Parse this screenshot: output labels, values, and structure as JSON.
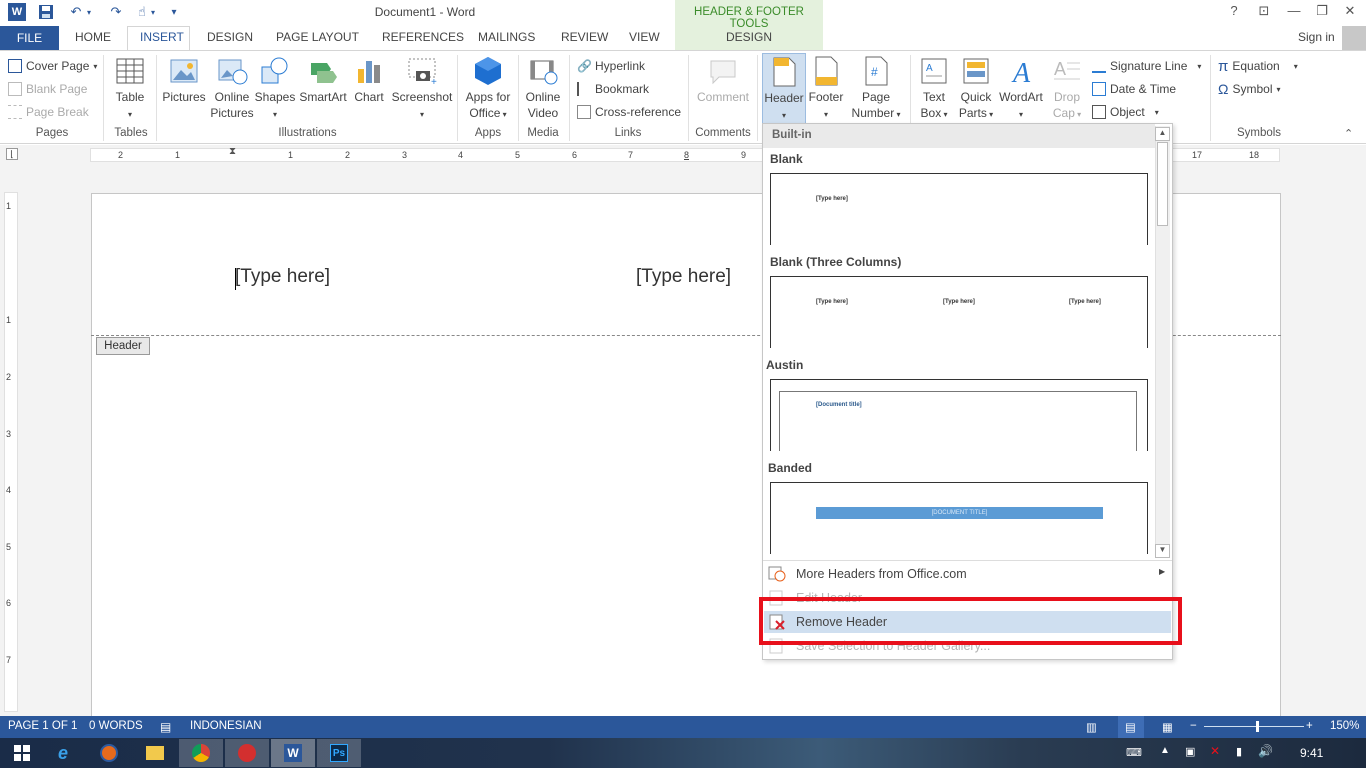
{
  "window": {
    "title": "Document1 - Word",
    "contextual_group": "HEADER & FOOTER TOOLS",
    "contextual_tab": "DESIGN",
    "help": "?",
    "sign_in": "Sign in"
  },
  "tabs": [
    "FILE",
    "HOME",
    "INSERT",
    "DESIGN",
    "PAGE LAYOUT",
    "REFERENCES",
    "MAILINGS",
    "REVIEW",
    "VIEW"
  ],
  "ribbon": {
    "pages": {
      "label": "Pages",
      "cover_page": "Cover Page",
      "blank_page": "Blank Page",
      "page_break": "Page Break"
    },
    "tables": {
      "label": "Tables",
      "table": "Table"
    },
    "illustrations": {
      "label": "Illustrations",
      "pictures": "Pictures",
      "online_pictures_1": "Online",
      "online_pictures_2": "Pictures",
      "shapes": "Shapes",
      "smartart": "SmartArt",
      "chart": "Chart",
      "screenshot": "Screenshot"
    },
    "apps": {
      "label": "Apps",
      "apps_1": "Apps for",
      "apps_2": "Office"
    },
    "media": {
      "label": "Media",
      "video_1": "Online",
      "video_2": "Video"
    },
    "links": {
      "label": "Links",
      "hyperlink": "Hyperlink",
      "bookmark": "Bookmark",
      "cross_reference": "Cross-reference"
    },
    "comments": {
      "label": "Comments",
      "comment": "Comment"
    },
    "header_footer": {
      "header": "Header",
      "footer": "Footer",
      "page_number_1": "Page",
      "page_number_2": "Number"
    },
    "text": {
      "text_box_1": "Text",
      "text_box_2": "Box",
      "quick_parts_1": "Quick",
      "quick_parts_2": "Parts",
      "wordart": "WordArt",
      "drop_cap_1": "Drop",
      "drop_cap_2": "Cap",
      "signature_line": "Signature Line",
      "date_time": "Date & Time",
      "object": "Object"
    },
    "symbols": {
      "label": "Symbols",
      "equation": "Equation",
      "symbol": "Symbol"
    }
  },
  "ruler": {
    "ticks": [
      "2",
      "1",
      "1",
      "2",
      "3",
      "4",
      "5",
      "6",
      "7",
      "8",
      "9",
      "17",
      "18"
    ],
    "vticks": [
      "1",
      "1",
      "2",
      "3",
      "4",
      "5",
      "6",
      "7"
    ]
  },
  "document": {
    "header_left": "[Type here]",
    "header_center": "[Type here]",
    "header_tag": "Header"
  },
  "dropdown": {
    "section": "Built-in",
    "galleries": [
      {
        "name": "Blank",
        "samples": [
          "[Type here]"
        ]
      },
      {
        "name": "Blank (Three Columns)",
        "samples": [
          "[Type here]",
          "[Type here]",
          "[Type here]"
        ]
      },
      {
        "name": "Austin",
        "samples": [
          "[Document title]"
        ]
      },
      {
        "name": "Banded",
        "samples": [
          "[DOCUMENT TITLE]"
        ]
      }
    ],
    "menu": [
      {
        "label": "More Headers from Office.com",
        "enabled": true
      },
      {
        "label": "Edit Header",
        "enabled": false
      },
      {
        "label": "Remove Header",
        "enabled": true,
        "highlighted": true
      },
      {
        "label": "Save Selection to Header Gallery...",
        "enabled": false
      }
    ]
  },
  "status": {
    "page": "PAGE 1 OF 1",
    "words": "0 WORDS",
    "language": "INDONESIAN",
    "zoom": "150%"
  },
  "taskbar": {
    "time": "9:41"
  },
  "colors": {
    "accent": "#2b579a",
    "contextual": "#3b8c2a",
    "highlight_box": "#e8101b"
  }
}
